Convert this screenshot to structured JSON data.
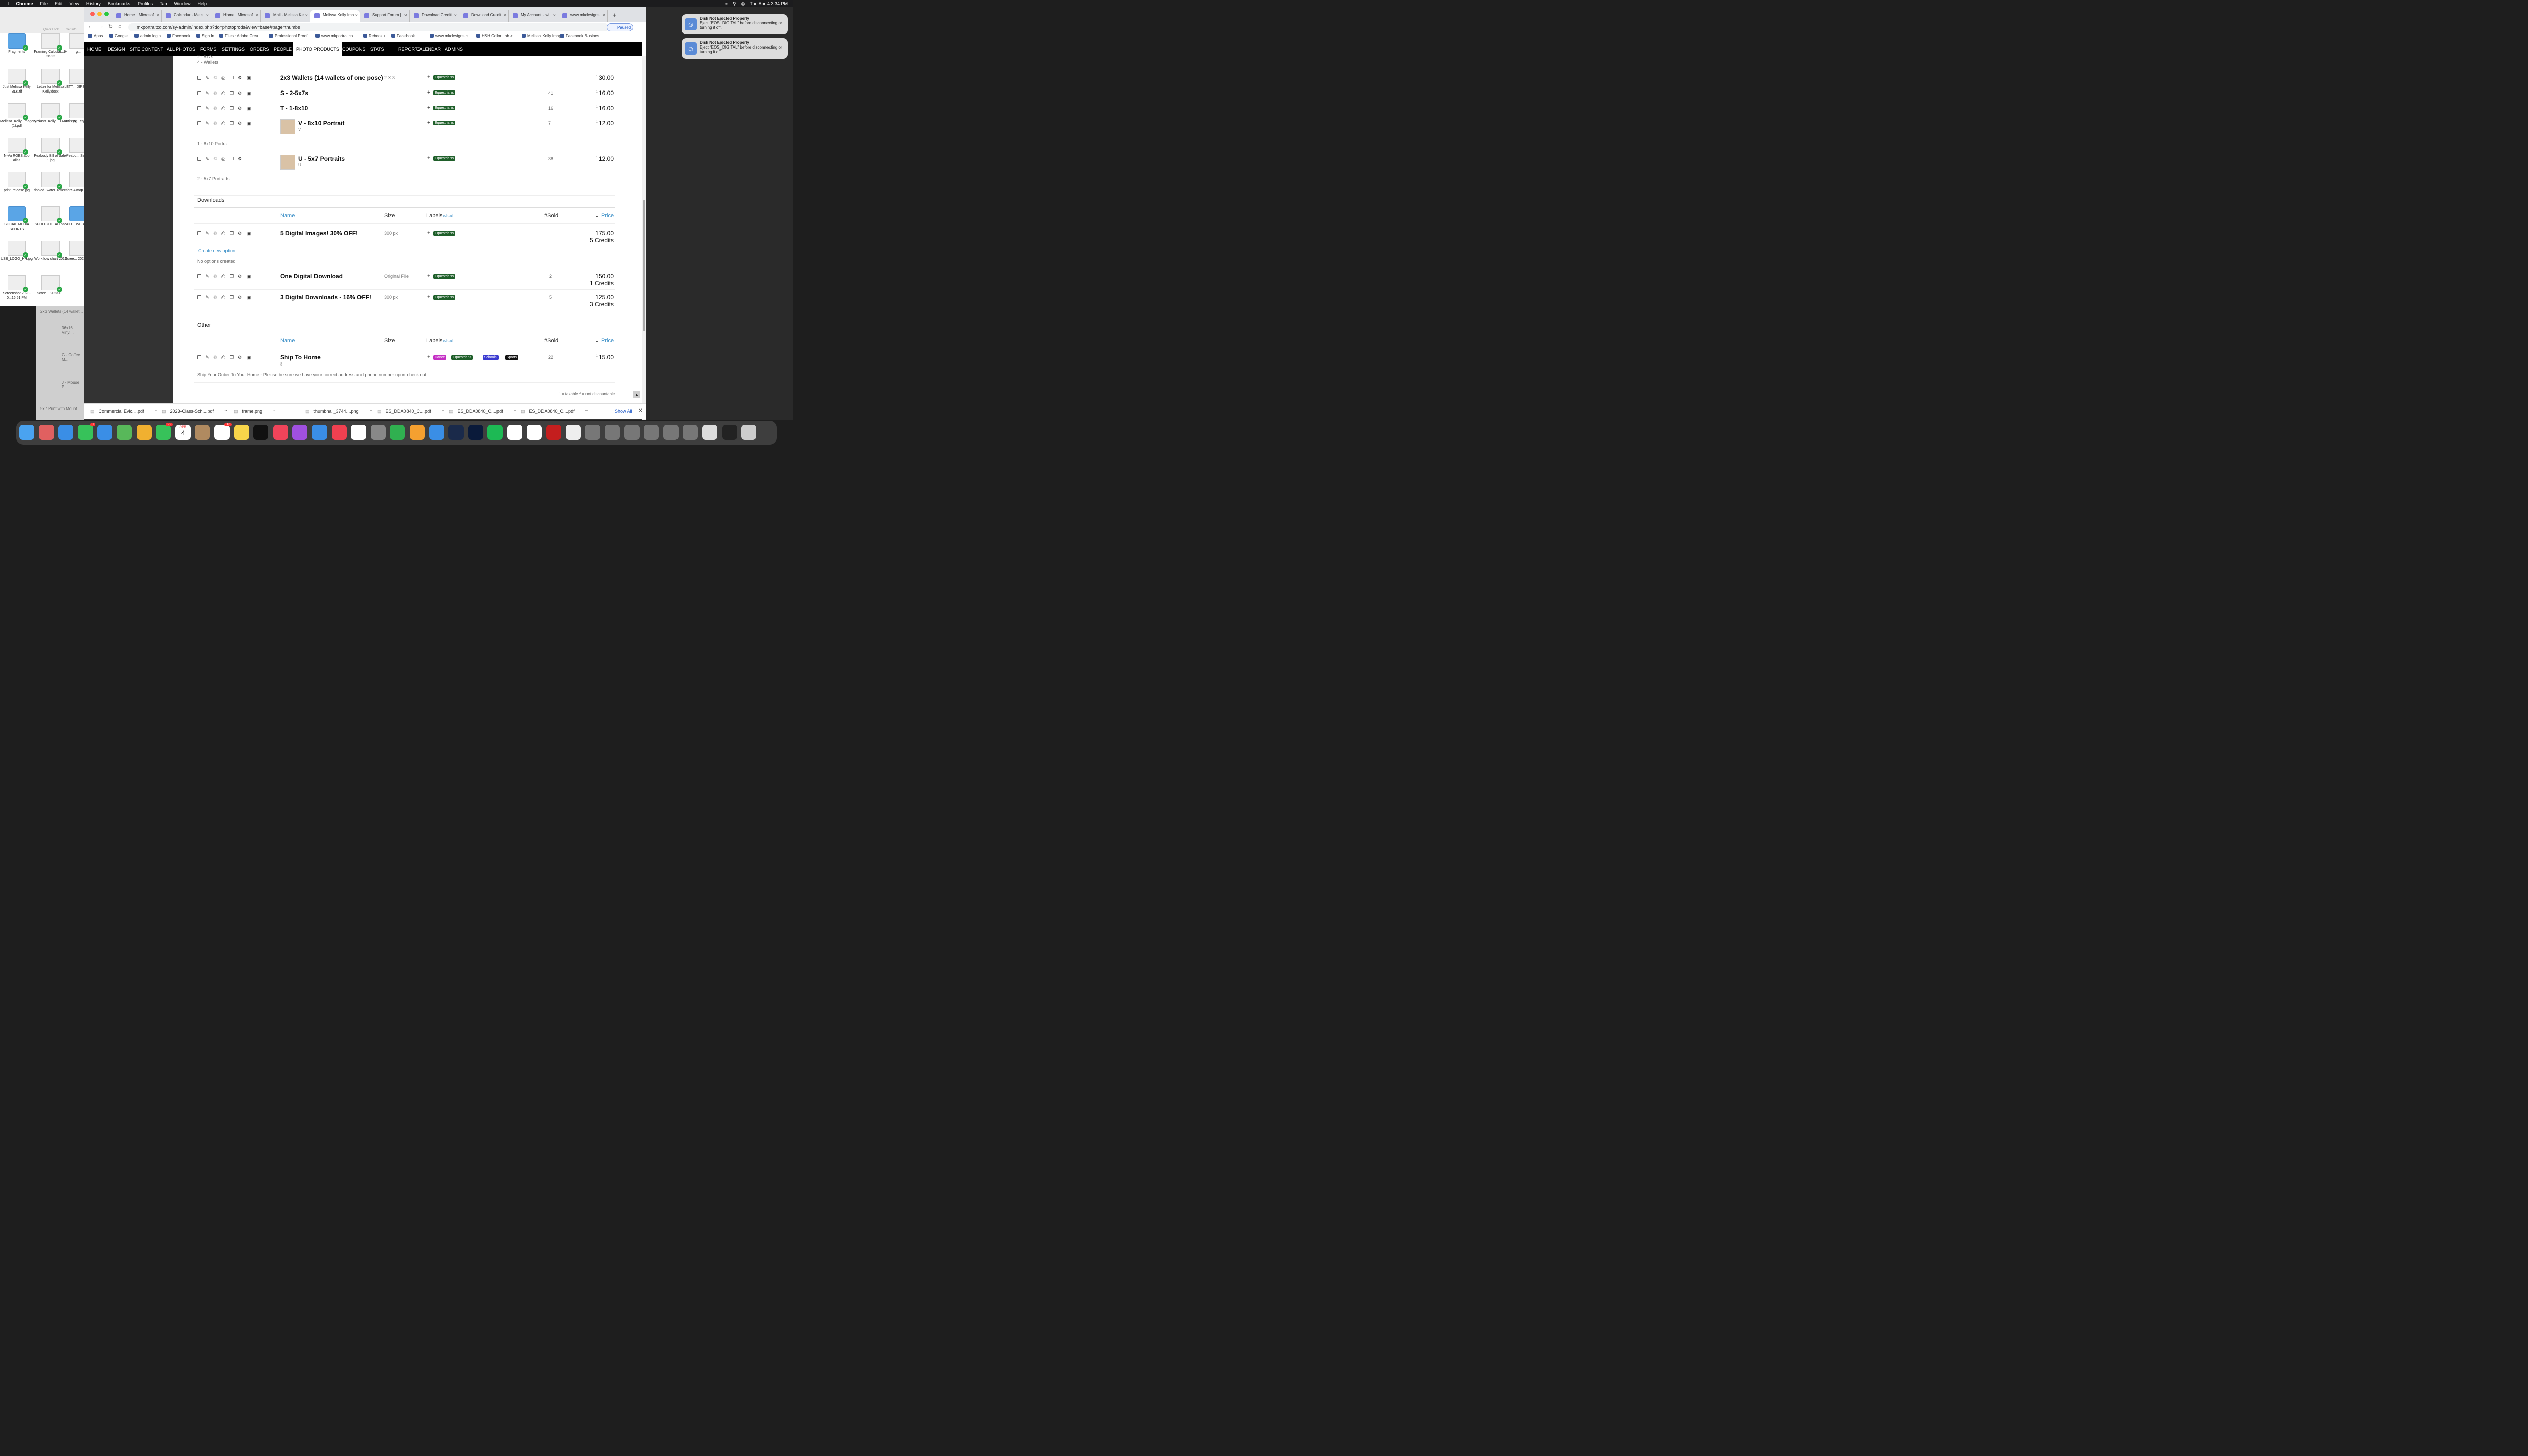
{
  "menubar": {
    "app": "Chrome",
    "items": [
      "File",
      "Edit",
      "View",
      "History",
      "Bookmarks",
      "Profiles",
      "Tab",
      "Window",
      "Help"
    ],
    "datetime": "Tue Apr 4  3:34 PM"
  },
  "notifications": [
    {
      "title": "Disk Not Ejected Properly",
      "body": "Eject “EOS_DIGITAL” before disconnecting or turning it off."
    },
    {
      "title": "Disk Not Ejected Properly",
      "body": "Eject “EOS_DIGITAL” before disconnecting or turning it off."
    }
  ],
  "finder": {
    "toolbar": [
      "Quick Look",
      "Get Info"
    ],
    "items": [
      "Fragments",
      "Framing Calculat...9-26-22",
      "g...",
      "Just Melissa Kelly BLK.tif",
      "Letter for Melissa Kelly.docx",
      "LETT... DIRECT...",
      "Melissa_Kelly_Imagery_W9 (1).pdf",
      "Melissa_Kelly_L1A9445.jpg",
      "Melissa... ery Sli...",
      "N-Vu ROES.app alias",
      "Peabody Bill of Sale-1.jpg",
      "Peabo... Sale...",
      "print_release.jpg",
      "rippled_water_reflection_...map.psd",
      "SA1 - 4...",
      "SOCIAL MEDIA SPORTS",
      "SPOLIGHT_AD.psd",
      "SPO... WEBSIT...",
      "USB_LOGO_HH.jpg",
      "Workflow chart 2013",
      "Scree... 2023-0...",
      "Screenshot 2023-0...16.51 PM",
      "Scree... 2023-0..."
    ]
  },
  "behind_window": [
    "2x3 Wallets (14 wallet...",
    "36x16 Vinyl...",
    "G - Coffee M...",
    "J - Mouse P...",
    "5x7 Print with Mount..."
  ],
  "tabs": [
    "Home | Microsof",
    "Calendar - Melis",
    "Home | Microsof",
    "Mail - Melissa Ke",
    "Melissa Kelly Ima",
    "Support Forum |",
    "Download Credit",
    "Download Credit",
    "My Account - wi",
    "www.mkdesigns."
  ],
  "url": "mkportraitco.com/sy-admin/index.php?do=photoprods&view=base#page=thumbs",
  "profile_status": "Paused",
  "bookmarks": [
    "Apps",
    "Google",
    "admin login",
    "Facebook",
    "Sign In",
    "Files : Adobe Crea...",
    "Professional Proof...",
    "www.mkportraitco...",
    "Rebooku",
    "Facebook",
    "www.mkdesigns.c...",
    "H&H Color Lab >...",
    "Melissa Kelly Imag...",
    "Facebook Busines..."
  ],
  "admin_nav": [
    "HOME",
    "DESIGN",
    "SITE CONTENT",
    "ALL PHOTOS",
    "FORMS",
    "SETTINGS",
    "ORDERS",
    "PEOPLE",
    "PHOTO PRODUCTS",
    "COUPONS",
    "STATS",
    "REPORTS",
    "CALENDAR",
    "ADMINS"
  ],
  "top_notes": [
    "2 - 5x7s",
    "4 - Wallets"
  ],
  "prints": [
    {
      "name": "2x3 Wallets (14 wallets of one pose)",
      "size": "2 X 3",
      "labels": [
        "Equestrians"
      ],
      "sold": "",
      "price": "30.00",
      "badge": "1"
    },
    {
      "name": "S - 2-5x7s",
      "size": "",
      "labels": [
        "Equestrians"
      ],
      "sold": "41",
      "price": "16.00",
      "badge": "2"
    },
    {
      "name": "T - 1-8x10",
      "size": "",
      "labels": [
        "Equestrians"
      ],
      "sold": "16",
      "price": "16.00",
      "badge": "1"
    },
    {
      "name": "V - 8x10 Portrait",
      "sub": "V",
      "size": "",
      "labels": [
        "Equestrians"
      ],
      "sold": "7",
      "price": "12.00",
      "badge": "2",
      "note": "1 - 8x10 Portrait"
    },
    {
      "name": "U - 5x7 Portraits",
      "sub": "U",
      "size": "",
      "labels": [
        "Equestrians"
      ],
      "sold": "38",
      "price": "12.00",
      "badge": "",
      "note": "2 - 5x7 Portraits"
    }
  ],
  "downloads_section": {
    "title": "Downloads",
    "headers": {
      "name": "Name",
      "size": "Size",
      "labels": "Labels",
      "edit_all": "edit all",
      "sold": "#Sold",
      "price": "Price"
    },
    "items": [
      {
        "name": "5 Digital Images! 30% OFF!",
        "size": "300 px",
        "labels": [
          "Equestrians"
        ],
        "sold": "",
        "price": "175.00",
        "credits": "5 Credits"
      },
      {
        "name": "One Digital Download",
        "size": "Original File",
        "labels": [
          "Equestrians"
        ],
        "sold": "2",
        "price": "150.00",
        "credits": "1 Credits"
      },
      {
        "name": "3 Digital Downloads - 16% OFF!",
        "size": "300 px",
        "labels": [
          "Equestrians"
        ],
        "sold": "5",
        "price": "125.00",
        "credits": "3 Credits"
      }
    ],
    "create_option": "Create new option",
    "no_options": "No options created"
  },
  "other_section": {
    "title": "Other",
    "headers": {
      "name": "Name",
      "size": "Size",
      "labels": "Labels",
      "edit_all": "edit all",
      "sold": "#Sold",
      "price": "Price"
    },
    "items": [
      {
        "name": "Ship To Home",
        "sub": "8",
        "size": "",
        "labels": [
          "Dance",
          "Equestrians",
          "Schools",
          "Sports"
        ],
        "sold": "22",
        "price": "15.00"
      }
    ],
    "note": "Ship Your Order To Your Home - Please be sure we have your correct address and phone number upon check out."
  },
  "footer_legend": "¹ = taxable  ᵈ = not discountable",
  "label_colors": {
    "Equestrians": "#1f5f2a",
    "Dance": "#c42fc4",
    "Schools": "#3a3ad0",
    "Sports": "#111111"
  },
  "downloads_bar": {
    "files": [
      "Commercial Evic....pdf",
      "2023-Class-Sch....pdf",
      "frame.png",
      "thumbnail_3744....png",
      "ES_DDA0840_C....pdf",
      "ES_DDA0840_C....pdf",
      "ES_DDA0840_C....pdf"
    ],
    "show_all": "Show All"
  },
  "dock": {
    "calendar_month": "APR",
    "calendar_day": "4",
    "messages_badge": "9",
    "facetime_badge": "22",
    "reminders_badge": "13"
  }
}
